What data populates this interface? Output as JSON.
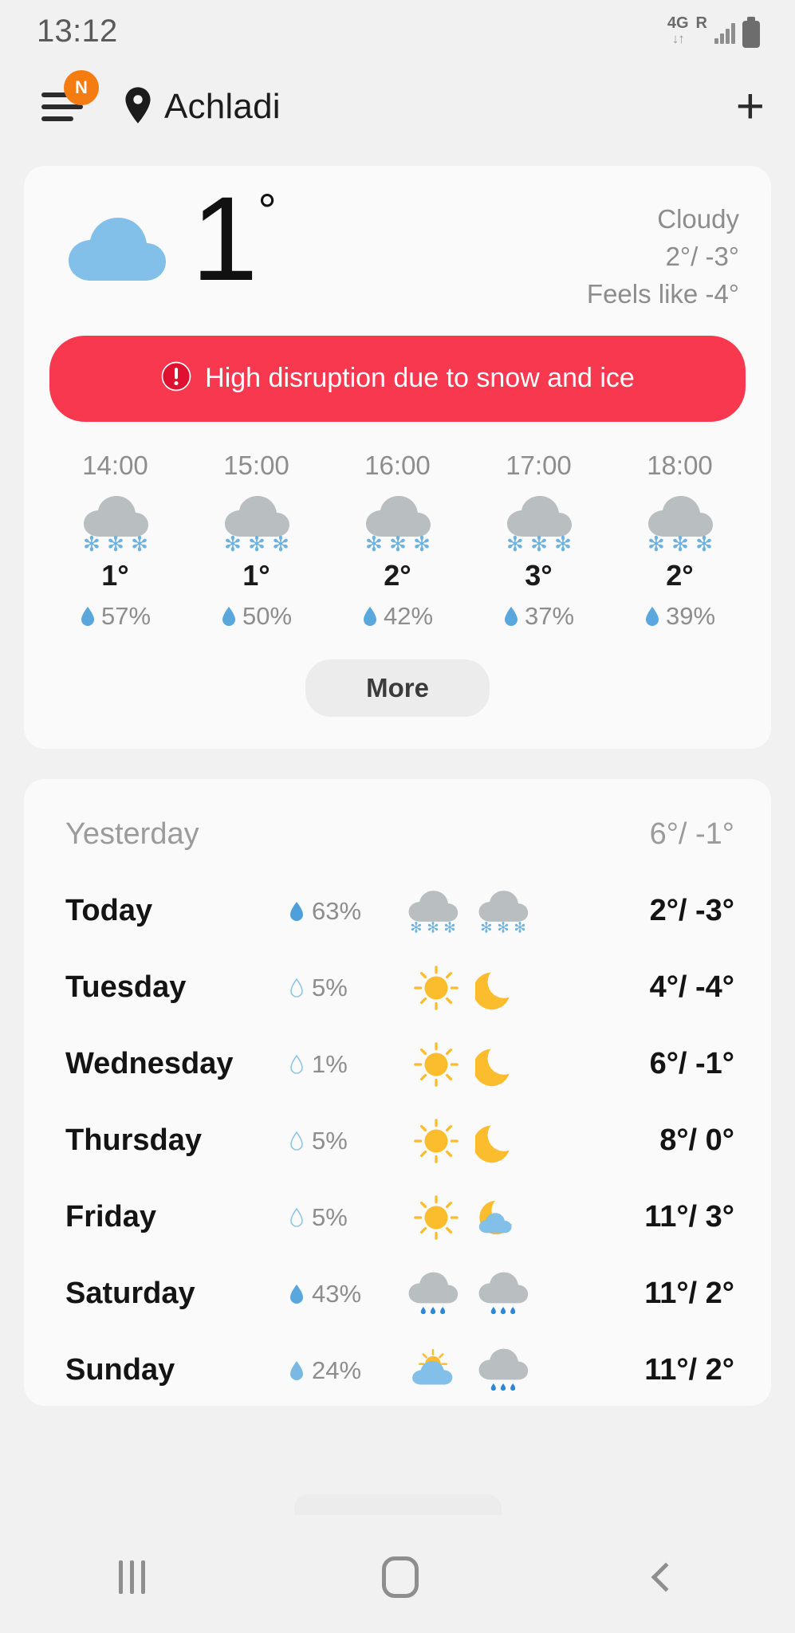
{
  "status_bar": {
    "time": "13:12",
    "network_type": "4G",
    "data_arrows": "↓↑",
    "roaming": "R",
    "signal_icon": "signal-bars-icon",
    "battery_icon": "battery-icon"
  },
  "app_bar": {
    "menu_icon": "hamburger-menu-icon",
    "badge": "N",
    "location_icon": "location-pin-icon",
    "city": "Achladi",
    "add_icon": "+"
  },
  "current": {
    "icon": "cloudy-icon",
    "temperature": "1",
    "degree": "°",
    "condition": "Cloudy",
    "high_low": "2°/ -3°",
    "feels_like": "Feels like -4°"
  },
  "alert": {
    "icon": "warning-icon",
    "text": "High disruption due to snow and ice",
    "color": "#f8384f"
  },
  "hourly": [
    {
      "time": "14:00",
      "icon": "snow-cloud-icon",
      "temp": "1°",
      "pop": "57%"
    },
    {
      "time": "15:00",
      "icon": "snow-cloud-icon",
      "temp": "1°",
      "pop": "50%"
    },
    {
      "time": "16:00",
      "icon": "snow-cloud-icon",
      "temp": "2°",
      "pop": "42%"
    },
    {
      "time": "17:00",
      "icon": "snow-cloud-icon",
      "temp": "3°",
      "pop": "37%"
    },
    {
      "time": "18:00",
      "icon": "snow-cloud-icon",
      "temp": "2°",
      "pop": "39%"
    }
  ],
  "more_button": "More",
  "daily": [
    {
      "day": "Yesterday",
      "pop": "",
      "day_icon": "",
      "night_icon": "",
      "temp": "6°/ -1°",
      "muted": true
    },
    {
      "day": "Today",
      "pop": "63%",
      "day_icon": "snow-cloud-icon",
      "night_icon": "snow-cloud-icon",
      "temp": "2°/ -3°",
      "muted": false
    },
    {
      "day": "Tuesday",
      "pop": "5%",
      "day_icon": "sun-icon",
      "night_icon": "moon-icon",
      "temp": "4°/ -4°",
      "muted": false
    },
    {
      "day": "Wednesday",
      "pop": "1%",
      "day_icon": "sun-icon",
      "night_icon": "moon-icon",
      "temp": "6°/ -1°",
      "muted": false
    },
    {
      "day": "Thursday",
      "pop": "5%",
      "day_icon": "sun-icon",
      "night_icon": "moon-icon",
      "temp": "8°/ 0°",
      "muted": false
    },
    {
      "day": "Friday",
      "pop": "5%",
      "day_icon": "sun-icon",
      "night_icon": "moon-cloud-icon",
      "temp": "11°/ 3°",
      "muted": false
    },
    {
      "day": "Saturday",
      "pop": "43%",
      "day_icon": "rain-cloud-icon",
      "night_icon": "rain-cloud-icon",
      "temp": "11°/ 2°",
      "muted": false
    },
    {
      "day": "Sunday",
      "pop": "24%",
      "day_icon": "sun-cloud-icon",
      "night_icon": "rain-cloud-icon",
      "temp": "11°/ 2°",
      "muted": false
    }
  ],
  "nav_bar": {
    "recents_icon": "recents-icon",
    "home_icon": "home-icon",
    "back_icon": "back-icon"
  }
}
